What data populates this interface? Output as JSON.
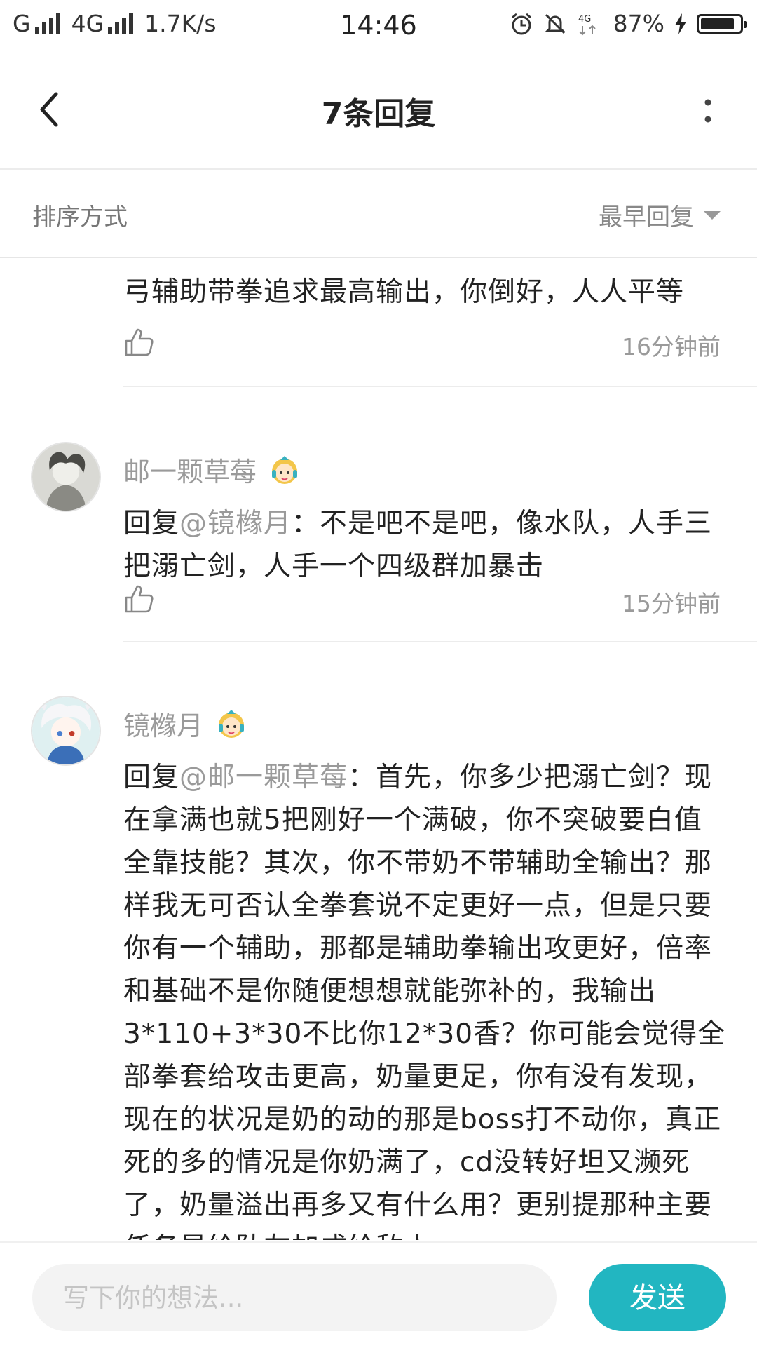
{
  "status_bar": {
    "carrier": "G",
    "network": "4G",
    "speed": "1.7K/s",
    "time": "14:46",
    "net2": "4G",
    "battery_pct": "87%",
    "battery_level": 0.87,
    "icons": [
      "alarm-icon",
      "mute-icon",
      "signal-4g-icon",
      "charging-icon",
      "battery-icon"
    ]
  },
  "nav": {
    "title": "7条回复",
    "back_icon": "chevron-left-icon",
    "more_icon": "more-vertical-icon"
  },
  "sort": {
    "label": "排序方式",
    "selected": "最早回复"
  },
  "comments": [
    {
      "text": "弓辅助带拳追求最高输出，你倒好，人人平等",
      "time": "16分钟前"
    },
    {
      "author": "邮一颗草莓",
      "reply_prefix": "回复",
      "reply_to": "@镜橼月",
      "body": "：不是吧不是吧，像水队，人手三把溺亡剑，人手一个四级群加暴击",
      "time": "15分钟前"
    },
    {
      "author": "镜橼月",
      "reply_prefix": "回复",
      "reply_to": "@邮一颗草莓",
      "body": "：首先，你多少把溺亡剑？现在拿满也就5把刚好一个满破，你不突破要白值全靠技能？其次，你不带奶不带辅助全输出？那样我无可否认全拳套说不定更好一点，但是只要你有一个辅助，那都是辅助拳输出攻更好，倍率和基础不是你随便想想就能弥补的，我输出3*110+3*30不比你12*30香？你可能会觉得全部拳套给攻击更高，奶量更足，你有没有发现，现在的状况是奶的动的那是boss打不动你，真正死的多的情况是你奶满了，cd没转好坦又濒死了，奶量溢出再多又有什么用？更别提那种主要任务是给队友加成给敌人"
    }
  ],
  "composer": {
    "placeholder": "写下你的想法...",
    "send_label": "发送",
    "accent": "#22b6c1"
  }
}
